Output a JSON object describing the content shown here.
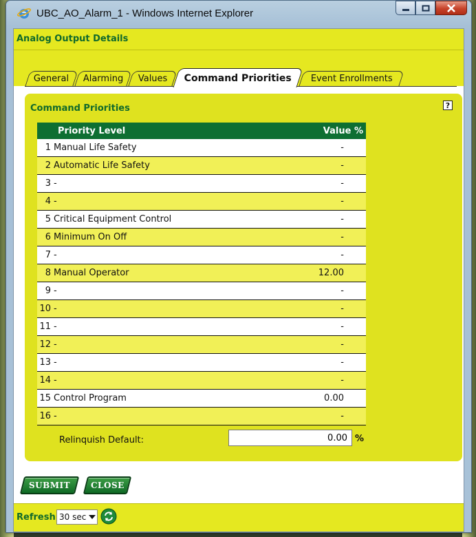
{
  "window": {
    "title": "UBC_AO_Alarm_1 - Windows Internet Explorer",
    "accent": "#e5e820",
    "brand_green": "#10692b"
  },
  "page_header": "Analog Output Details",
  "tabs": [
    {
      "label": "General",
      "active": false
    },
    {
      "label": "Alarming",
      "active": false
    },
    {
      "label": "Values",
      "active": false
    },
    {
      "label": "Command Priorities",
      "active": true
    },
    {
      "label": "Event Enrollments",
      "active": false
    }
  ],
  "panel": {
    "title": "Command Priorities",
    "help_label": "?",
    "columns": {
      "priority": "Priority Level",
      "value": "Value %"
    },
    "rows": [
      {
        "num": "1",
        "name": "Manual Life Safety",
        "value": "-"
      },
      {
        "num": "2",
        "name": "Automatic Life Safety",
        "value": "-"
      },
      {
        "num": "3",
        "name": "-",
        "value": "-"
      },
      {
        "num": "4",
        "name": "-",
        "value": "-"
      },
      {
        "num": "5",
        "name": "Critical Equipment Control",
        "value": "-"
      },
      {
        "num": "6",
        "name": "Minimum On Off",
        "value": "-"
      },
      {
        "num": "7",
        "name": "-",
        "value": "-"
      },
      {
        "num": "8",
        "name": "Manual Operator",
        "value": "12.00"
      },
      {
        "num": "9",
        "name": "-",
        "value": "-"
      },
      {
        "num": "10",
        "name": "-",
        "value": "-"
      },
      {
        "num": "11",
        "name": "-",
        "value": "-"
      },
      {
        "num": "12",
        "name": "-",
        "value": "-"
      },
      {
        "num": "13",
        "name": "-",
        "value": "-"
      },
      {
        "num": "14",
        "name": "-",
        "value": "-"
      },
      {
        "num": "15",
        "name": "Control Program",
        "value": "0.00"
      },
      {
        "num": "16",
        "name": "-",
        "value": "-"
      }
    ],
    "relinquish_label": "Relinquish Default:",
    "relinquish_value": "0.00",
    "relinquish_unit": "%"
  },
  "buttons": {
    "submit": "SUBMIT",
    "close": "CLOSE"
  },
  "footer": {
    "refresh_label": "Refresh:",
    "refresh_value": "30 sec"
  }
}
